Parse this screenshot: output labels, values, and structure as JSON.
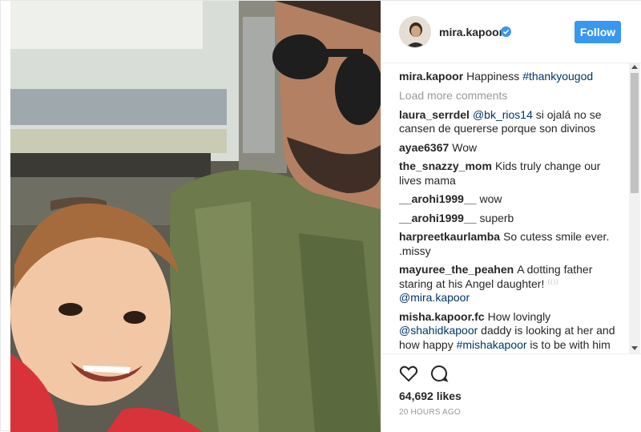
{
  "post": {
    "username": "mira.kapoor",
    "follow_label": "Follow",
    "caption": {
      "user": "mira.kapoor",
      "text": "Happiness ",
      "hashtag": "#thankyougod"
    },
    "load_more_label": "Load more comments",
    "comments": [
      {
        "user": "laura_serrdel",
        "mention": "@bk_rios14",
        "text": " si ojalá no se cansen de quererse porque son divinos"
      },
      {
        "user": "ayae6367",
        "text": "Wow"
      },
      {
        "user": "the_snazzy_mom",
        "text": "Kids truly change our lives mama"
      },
      {
        "user": "__arohi1999__",
        "text": "wow"
      },
      {
        "user": "__arohi1999__",
        "text": "superb"
      },
      {
        "user": "harpreetkaurlamba",
        "text": "So cutess smile ever. .missy"
      },
      {
        "user": "mayuree_the_peahen",
        "text": "A dotting father staring at his Angel daughter! ",
        "emoji": "⁽⁽⁾⁾",
        "mention": "@mira.kapoor"
      },
      {
        "user": "misha.kapoor.fc",
        "text": "How lovingly ",
        "mention": "@shahidkapoor",
        "text2": " daddy is looking at her and how happy ",
        "hashtag": "#mishakapoor",
        "text3": " is to be with him"
      }
    ],
    "likes": "64,692 likes",
    "timestamp": "20 HOURS AGO"
  },
  "icons": {
    "verified": "verified-badge-icon",
    "like": "heart-icon",
    "comment": "speech-bubble-icon"
  },
  "colors": {
    "follow_bg": "#3897f0",
    "link": "#003569",
    "muted": "#999999"
  }
}
